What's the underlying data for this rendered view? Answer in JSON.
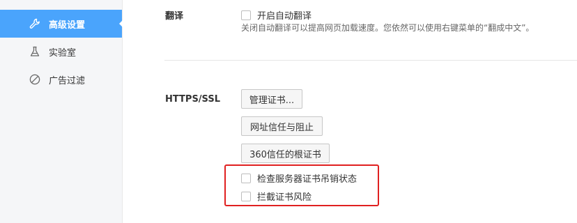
{
  "sidebar": {
    "items": [
      {
        "label": "高级设置",
        "icon": "wrench-icon",
        "active": true
      },
      {
        "label": "实验室",
        "icon": "flask-icon",
        "active": false
      },
      {
        "label": "广告过滤",
        "icon": "block-icon",
        "active": false
      }
    ]
  },
  "translate": {
    "section_label": "翻译",
    "auto_translate_label": "开启自动翻译",
    "auto_translate_checked": false,
    "description": "关闭自动翻译可以提高网页加载速度。您依然可以使用右键菜单的“翻成中文”。"
  },
  "https": {
    "section_label": "HTTPS/SSL",
    "manage_certs_button": "管理证书...",
    "site_trust_button": "网址信任与阻止",
    "root_certs_button": "360信任的根证书",
    "check_revocation_label": "检查服务器证书吊销状态",
    "check_revocation_checked": false,
    "intercept_risk_label": "拦截证书风险",
    "intercept_risk_checked": false
  },
  "colors": {
    "active_item_bg": "#4aa4fc",
    "highlight_border": "#e02020"
  }
}
